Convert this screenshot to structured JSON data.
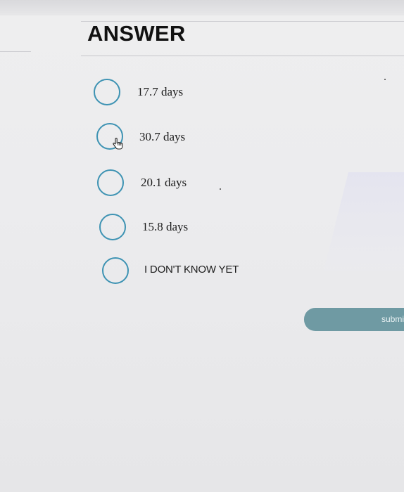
{
  "page": {
    "title": "ANSWER"
  },
  "options": [
    {
      "label": "17.7 days"
    },
    {
      "label": "30.7 days"
    },
    {
      "label": "20.1 days"
    },
    {
      "label": "15.8 days"
    },
    {
      "label": "I DON'T KNOW YET"
    }
  ],
  "submit": {
    "label": "submi"
  },
  "colors": {
    "radio_border": "#3e93b3",
    "submit_bg": "#6f9aa3"
  },
  "icons": {
    "cursor": "hand-pointer-icon"
  }
}
